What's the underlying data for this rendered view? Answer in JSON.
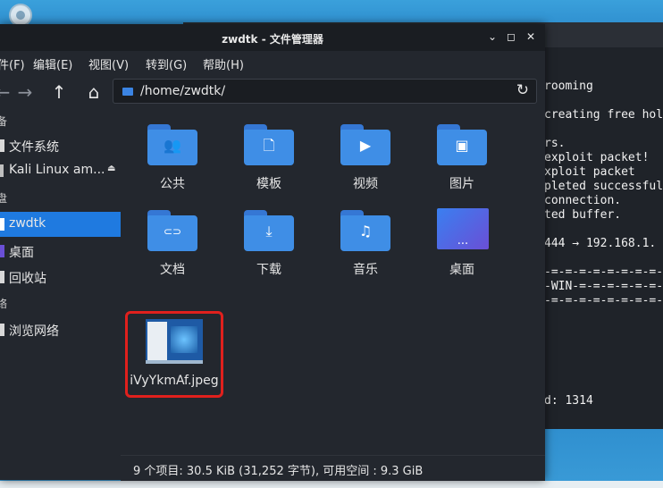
{
  "window": {
    "title": "zwdtk - 文件管理器",
    "minimize_glyph": "⌄",
    "maximize_glyph": "◻",
    "close_glyph": "✕"
  },
  "menu": [
    "件(F)",
    "编辑(E)",
    "视图(V)",
    "转到(G)",
    "帮助(H)"
  ],
  "toolbar": {
    "back_glyph": "←",
    "forward_glyph": "→",
    "up_glyph": "↑",
    "home_glyph": "⌂",
    "path": "/home/zwdtk/",
    "reload_glyph": "↻"
  },
  "sidebar": {
    "headers": [
      "备",
      "盘",
      "络"
    ],
    "items": [
      {
        "label": "文件系统",
        "active": false
      },
      {
        "label": "Kali Linux am...",
        "active": false
      },
      {
        "label": "zwdtk",
        "active": true
      },
      {
        "label": "桌面",
        "active": false
      },
      {
        "label": "回收站",
        "active": false
      },
      {
        "label": "浏览网络",
        "active": false
      }
    ],
    "eject_glyph": "⏏"
  },
  "files": [
    {
      "label": "公共",
      "icon": "users-icon",
      "glyph": "👥"
    },
    {
      "label": "模板",
      "icon": "template-icon",
      "glyph": "🗋"
    },
    {
      "label": "视频",
      "icon": "video-icon",
      "glyph": "▶"
    },
    {
      "label": "图片",
      "icon": "image-icon",
      "glyph": "▣"
    },
    {
      "label": "文档",
      "icon": "link-icon",
      "glyph": "⊂⊃"
    },
    {
      "label": "下载",
      "icon": "download-icon",
      "glyph": "⤓"
    },
    {
      "label": "音乐",
      "icon": "music-icon",
      "glyph": "♫"
    },
    {
      "label": "桌面",
      "icon": "desktop-icon",
      "glyph": "..."
    },
    {
      "label": "iVyYkmAf.jpeg",
      "icon": "image-thumbnail",
      "glyph": ""
    }
  ],
  "status": "9 个项目: 30.5 KiB (31,252 字节), 可用空间 : 9.3 GiB",
  "terminal": {
    "lines": [
      "rooming",
      "",
      "creating free hol",
      "",
      "rs.",
      "exploit packet!",
      "xploit packet",
      "pleted successful",
      "connection.",
      "ted buffer.",
      "",
      "444 → 192.168.1.",
      "",
      "-=-=-=-=-=-=-=-=-",
      "-WIN-=-=-=-=-=-=-",
      "-=-=-=-=-=-=-=-=-",
      "",
      "",
      "",
      "",
      "",
      "",
      "d: 1314"
    ]
  },
  "colors": {
    "accent": "#1f7ae0",
    "folder": "#3f8ee6",
    "selection_border": "#e0201d"
  }
}
